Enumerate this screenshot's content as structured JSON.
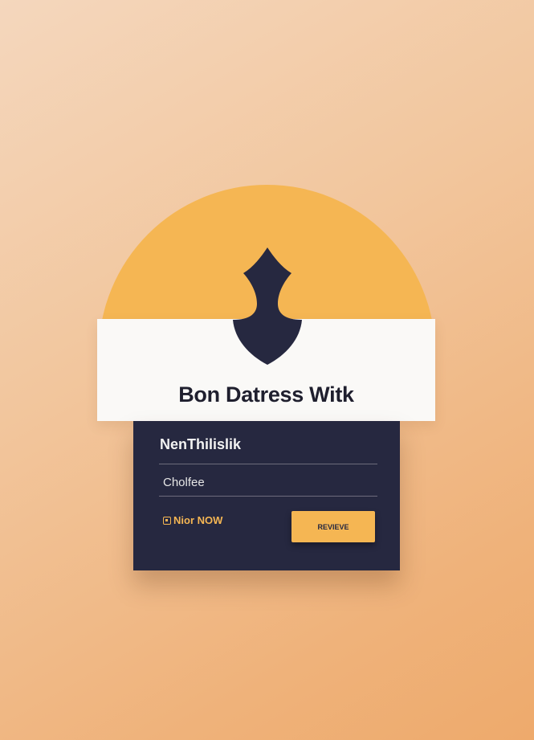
{
  "card": {
    "title": "Bon Datress Witk",
    "panel_heading": "NenThilislik",
    "field_label": "Cholfee",
    "status_text": "Nior NOW",
    "button_label": "REVIEVE"
  },
  "icons": {
    "emblem": "flame-shield-icon",
    "status": "square-icon"
  },
  "colors": {
    "accent": "#f5b653",
    "panel": "#262840",
    "banner": "#faf9f7",
    "text_dark": "#1f1f2e"
  }
}
